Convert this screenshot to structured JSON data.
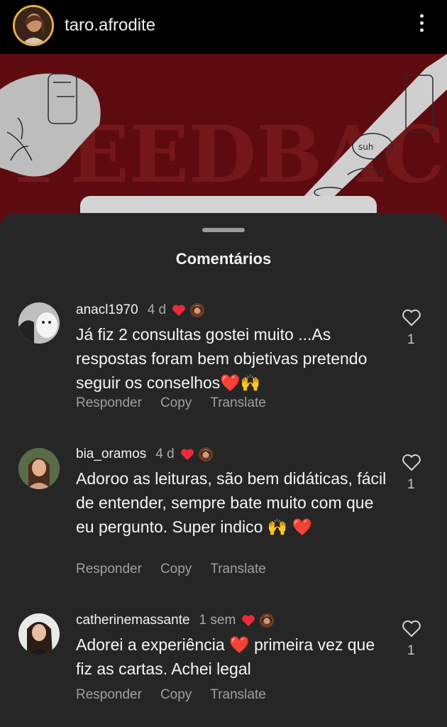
{
  "header": {
    "username": "taro.afrodite",
    "avatar_icon": "profile-photo",
    "menu_icon": "more-vertical-icon",
    "ring_color": "#e4b04a"
  },
  "post": {
    "background_color": "#5e0b0f",
    "image_text": "FEEDBACK"
  },
  "sheet": {
    "title": "Comentários",
    "background_color": "#262626"
  },
  "comments": [
    {
      "username": "anacl1970",
      "time": "4 d",
      "text": "Já fiz 2 consultas gostei muito ...As respostas foram bem objetivas pretendo seguir os conselhos❤️🙌",
      "likes": "1",
      "actions": [
        "Responder",
        "Copy",
        "Translate"
      ]
    },
    {
      "username": "bia_oramos",
      "time": "4 d",
      "text": "Adoroo as leituras, são bem didáticas, fácil de entender, sempre bate muito com que eu pergunto. Super indico 🙌 ❤️",
      "likes": "1",
      "actions": [
        "Responder",
        "Copy",
        "Translate"
      ]
    },
    {
      "username": "catherinemassante",
      "time": "1 sem",
      "text": "Adorei a experiência ❤️ primeira vez que fiz as cartas. Achei legal",
      "likes": "1",
      "actions": [
        "Responder",
        "Copy",
        "Translate"
      ]
    }
  ]
}
